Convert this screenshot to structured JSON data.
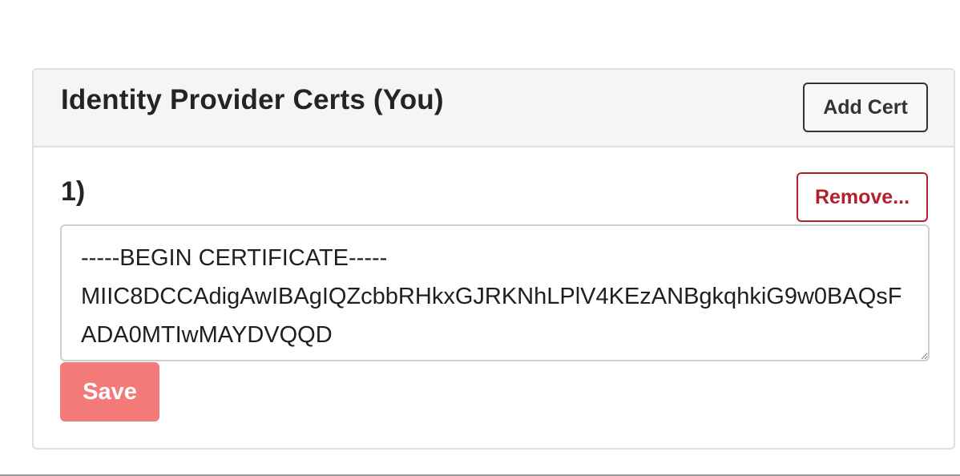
{
  "idp_certs": {
    "title": "Identity Provider Certs (You)",
    "add_cert_label": "Add Cert",
    "certs": [
      {
        "index_label": "1)",
        "remove_label": "Remove...",
        "value": "-----BEGIN CERTIFICATE-----\nMIIC8DCCAdigAwIBAgIQZcbbRHkxGJRKNhLPlV4KEzANBgkqhkiG9w0BAQsFADA0MTIwMAYDVQQD"
      }
    ],
    "save_label": "Save"
  },
  "colors": {
    "danger": "#b3202c",
    "save_button": "#f47a7a",
    "header_background": "#f5f5f5"
  }
}
